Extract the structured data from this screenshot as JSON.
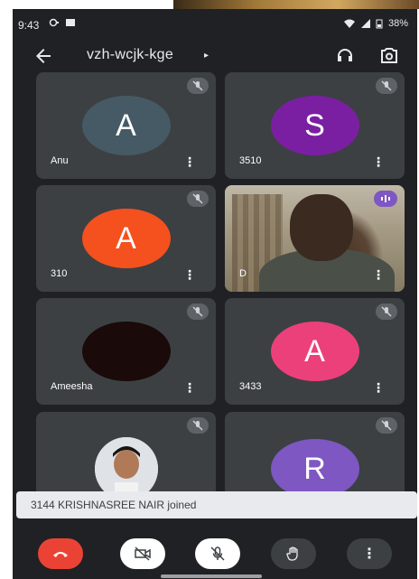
{
  "status_bar": {
    "time": "9:43",
    "battery": "38%"
  },
  "header": {
    "meeting_code": "vzh-wcjk-kge",
    "caret": "▸"
  },
  "participants": [
    {
      "name": "Anu",
      "initial": "A",
      "color": "#455a64",
      "muted": true
    },
    {
      "name": "3510",
      "initial": "S",
      "color": "#7b1fa2",
      "muted": true
    },
    {
      "name": "310",
      "initial": "A",
      "color": "#f4511e",
      "muted": true
    },
    {
      "name": "D",
      "video": true,
      "speaking": true
    },
    {
      "name": "Ameesha",
      "color": "#1a0a0a",
      "muted": true
    },
    {
      "name": "3433",
      "initial": "A",
      "color": "#ec407a",
      "muted": true
    },
    {
      "name": "",
      "photo": true,
      "muted": true
    },
    {
      "name": "",
      "initial": "R",
      "color": "#7e57c2",
      "muted": true
    }
  ],
  "toast": {
    "message": "3144 KRISHNASREE NAIR joined"
  },
  "controls": {
    "more_label": "⋮"
  },
  "colors": {
    "background": "#202124",
    "tile": "#3c4043",
    "end_call": "#ea4335"
  }
}
